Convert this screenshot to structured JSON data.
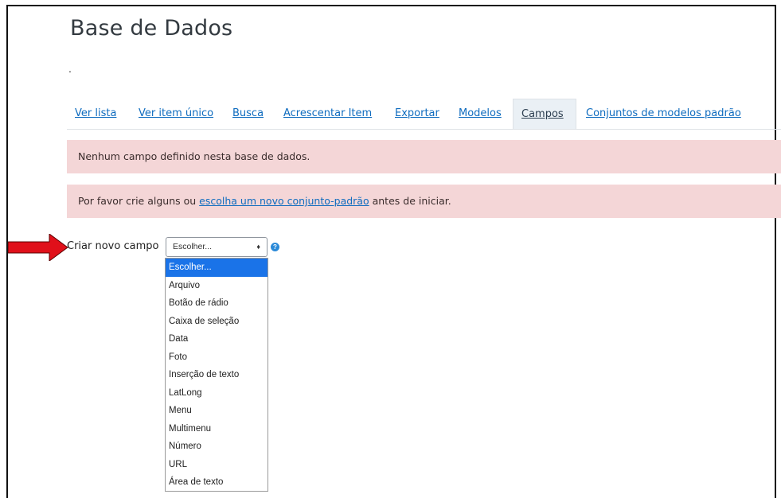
{
  "page": {
    "title": "Base de Dados",
    "dot": "."
  },
  "tabs": [
    {
      "label": "Ver lista"
    },
    {
      "label": "Ver item único"
    },
    {
      "label": "Busca"
    },
    {
      "label": "Acrescentar Item"
    },
    {
      "label": "Exportar"
    },
    {
      "label": "Modelos"
    },
    {
      "label": "Campos",
      "active": true
    },
    {
      "label": "Conjuntos de modelos padrão"
    }
  ],
  "alerts": {
    "no_fields": "Nenhum campo definido nesta base de dados.",
    "create_prefix": "Por favor crie alguns ou ",
    "create_link": "escolha um novo conjunto-padrão",
    "create_suffix": " antes de iniciar."
  },
  "create_field": {
    "label": "Criar novo campo",
    "selected": "Escolher...",
    "options": [
      "Escolher...",
      "Arquivo",
      "Botão de rádio",
      "Caixa de seleção",
      "Data",
      "Foto",
      "Inserção de texto",
      "LatLong",
      "Menu",
      "Multimenu",
      "Número",
      "URL",
      "Área de texto"
    ]
  },
  "colors": {
    "link": "#0f6cbf",
    "alert_bg": "#f4d6d7",
    "arrow": "#e0101a",
    "selected_option": "#1a73e8"
  }
}
